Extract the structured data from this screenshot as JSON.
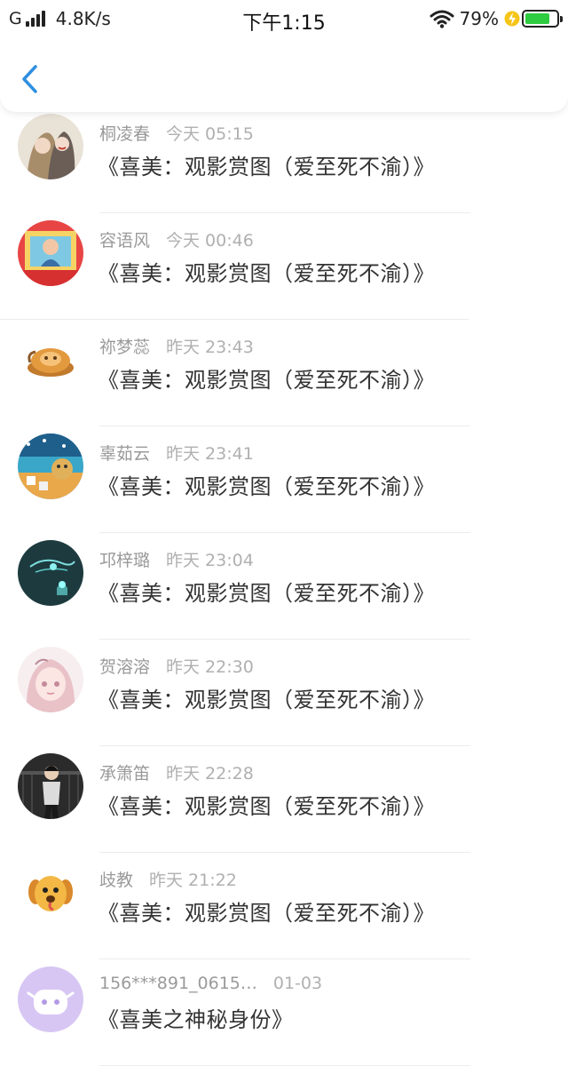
{
  "status_bar": {
    "carrier": "G",
    "net_speed": "4.8K/s",
    "time": "下午1:15",
    "battery_percent": "79%",
    "battery_level": 0.79,
    "battery_color": "#2ecc40"
  },
  "nav": {
    "back_icon": "chevron-left-icon",
    "accent": "#2f8fe0"
  },
  "comments": [
    {
      "name": "桐凌春",
      "time": "今天 05:15",
      "title": "《喜美：观影赏图（爱至死不渝）》",
      "avatar": "avatar-1"
    },
    {
      "name": "容语风",
      "time": "今天 00:46",
      "title": "《喜美：观影赏图（爱至死不渝）》",
      "avatar": "avatar-2"
    },
    {
      "name": "祢梦蕊",
      "time": "昨天 23:43",
      "title": "《喜美：观影赏图（爱至死不渝）》",
      "avatar": "avatar-3"
    },
    {
      "name": "辜茹云",
      "time": "昨天 23:41",
      "title": "《喜美：观影赏图（爱至死不渝）》",
      "avatar": "avatar-4"
    },
    {
      "name": "邛梓璐",
      "time": "昨天 23:04",
      "title": "《喜美：观影赏图（爱至死不渝）》",
      "avatar": "avatar-5"
    },
    {
      "name": "贺溶溶",
      "time": "昨天 22:30",
      "title": "《喜美：观影赏图（爱至死不渝）》",
      "avatar": "avatar-6"
    },
    {
      "name": "承箫笛",
      "time": "昨天 22:28",
      "title": "《喜美：观影赏图（爱至死不渝）》",
      "avatar": "avatar-7"
    },
    {
      "name": "歧教",
      "time": "昨天 21:22",
      "title": "《喜美：观影赏图（爱至死不渝）》",
      "avatar": "avatar-8"
    },
    {
      "name": "156***891_0615…",
      "time": "01-03",
      "title": "《喜美之神秘身份》",
      "avatar": "avatar-9"
    }
  ]
}
